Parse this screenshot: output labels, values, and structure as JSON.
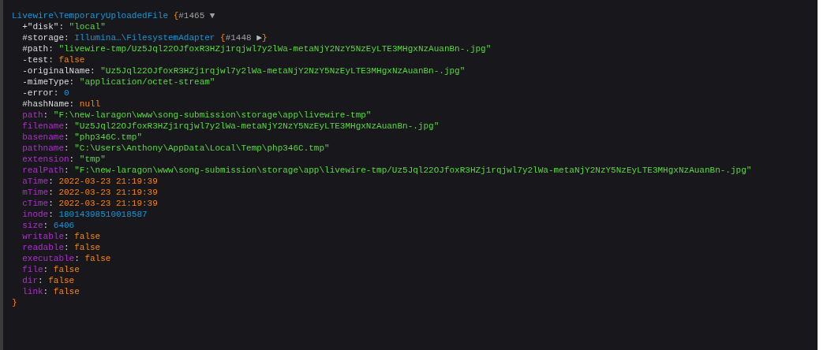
{
  "dump": {
    "class": "Livewire\\TemporaryUploadedFile",
    "open": "{",
    "id": "#1465",
    "toggle": "▼",
    "expanded": true,
    "close": "}",
    "separator": ":",
    "properties": [
      {
        "virtual": false,
        "key": "+\"disk\"",
        "kind": "string",
        "value": "\"local\""
      },
      {
        "virtual": false,
        "key": "#storage",
        "kind": "object",
        "value": "Illumina…\\FilesystemAdapter",
        "open": "{",
        "id": "#1448",
        "toggle": "▶",
        "expanded": false,
        "close": "}"
      },
      {
        "virtual": false,
        "key": "#path",
        "kind": "string",
        "value": "\"livewire-tmp/Uz5Jql22OJfoxR3HZj1rqjwl7y2lWa-metaNjY2NzY5NzEyLTE3MHgxNzAuanBn-.jpg\""
      },
      {
        "virtual": false,
        "key": "-test",
        "kind": "const",
        "value": "false"
      },
      {
        "virtual": false,
        "key": "-originalName",
        "kind": "string",
        "value": "\"Uz5Jql22OJfoxR3HZj1rqjwl7y2lWa-metaNjY2NzY5NzEyLTE3MHgxNzAuanBn-.jpg\""
      },
      {
        "virtual": false,
        "key": "-mimeType",
        "kind": "string",
        "value": "\"application/octet-stream\""
      },
      {
        "virtual": false,
        "key": "-error",
        "kind": "number",
        "value": "0"
      },
      {
        "virtual": false,
        "key": "#hashName",
        "kind": "const",
        "value": "null"
      },
      {
        "virtual": true,
        "key": "path",
        "kind": "string",
        "value": "\"F:\\new-laragon\\www\\song-submission\\storage\\app\\livewire-tmp\""
      },
      {
        "virtual": true,
        "key": "filename",
        "kind": "string",
        "value": "\"Uz5Jql22OJfoxR3HZj1rqjwl7y2lWa-metaNjY2NzY5NzEyLTE3MHgxNzAuanBn-.jpg\""
      },
      {
        "virtual": true,
        "key": "basename",
        "kind": "string",
        "value": "\"php346C.tmp\""
      },
      {
        "virtual": true,
        "key": "pathname",
        "kind": "string",
        "value": "\"C:\\Users\\Anthony\\AppData\\Local\\Temp\\php346C.tmp\""
      },
      {
        "virtual": true,
        "key": "extension",
        "kind": "string",
        "value": "\"tmp\""
      },
      {
        "virtual": true,
        "key": "realPath",
        "kind": "string",
        "value": "\"F:\\new-laragon\\www\\song-submission\\storage\\app\\livewire-tmp/Uz5Jql22OJfoxR3HZj1rqjwl7y2lWa-metaNjY2NzY5NzEyLTE3MHgxNzAuanBn-.jpg\""
      },
      {
        "virtual": true,
        "key": "aTime",
        "kind": "date",
        "value": "2022-03-23 21:19:39"
      },
      {
        "virtual": true,
        "key": "mTime",
        "kind": "date",
        "value": "2022-03-23 21:19:39"
      },
      {
        "virtual": true,
        "key": "cTime",
        "kind": "date",
        "value": "2022-03-23 21:19:39"
      },
      {
        "virtual": true,
        "key": "inode",
        "kind": "number",
        "value": "18014398510018587"
      },
      {
        "virtual": true,
        "key": "size",
        "kind": "number",
        "value": "6406"
      },
      {
        "virtual": true,
        "key": "writable",
        "kind": "const",
        "value": "false"
      },
      {
        "virtual": true,
        "key": "readable",
        "kind": "const",
        "value": "false"
      },
      {
        "virtual": true,
        "key": "executable",
        "kind": "const",
        "value": "false"
      },
      {
        "virtual": true,
        "key": "file",
        "kind": "const",
        "value": "false"
      },
      {
        "virtual": true,
        "key": "dir",
        "kind": "const",
        "value": "false"
      },
      {
        "virtual": true,
        "key": "link",
        "kind": "const",
        "value": "false"
      }
    ]
  }
}
